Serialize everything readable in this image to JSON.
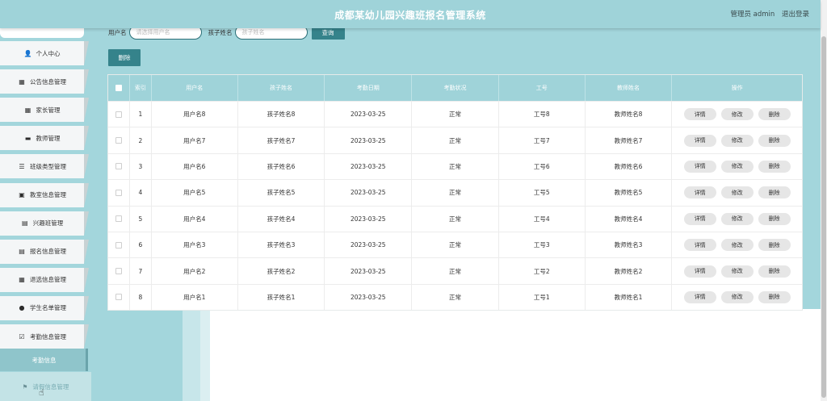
{
  "header": {
    "title": "成都某幼儿园兴趣班报名管理系统",
    "role": "管理员 admin",
    "logout": "退出登录"
  },
  "sidebar": {
    "items": [
      {
        "label": "个人中心",
        "icon": "user-icon"
      },
      {
        "label": "公告信息管理",
        "icon": "grid-icon"
      },
      {
        "label": "家长管理",
        "icon": "grid-icon"
      },
      {
        "label": "教师管理",
        "icon": "briefcase-icon"
      },
      {
        "label": "班级类型管理",
        "icon": "sliders-icon"
      },
      {
        "label": "教室信息管理",
        "icon": "classroom-icon"
      },
      {
        "label": "兴趣班管理",
        "icon": "clipboard-icon"
      },
      {
        "label": "报名信息管理",
        "icon": "document-icon"
      },
      {
        "label": "退选信息管理",
        "icon": "grid-icon"
      },
      {
        "label": "学生名单管理",
        "icon": "pin-icon"
      },
      {
        "label": "考勤信息管理",
        "icon": "check-icon"
      }
    ],
    "sub_item": "考勤信息",
    "last_item": {
      "label": "请假信息管理",
      "icon": "flag-icon"
    }
  },
  "search": {
    "username_label": "用户名",
    "username_placeholder": "请选择用户名",
    "child_label": "孩子姓名",
    "child_placeholder": "孩子姓名",
    "query_button": "查询"
  },
  "toolbar": {
    "delete_label": "删除"
  },
  "table": {
    "headers": [
      "索引",
      "用户名",
      "孩子姓名",
      "考勤日期",
      "考勤状况",
      "工号",
      "教师姓名",
      "操作"
    ],
    "actions": [
      "详情",
      "修改",
      "删除"
    ],
    "rows": [
      {
        "index": "1",
        "username": "用户名8",
        "child": "孩子姓名8",
        "date": "2023-03-25",
        "status": "正常",
        "job_no": "工号8",
        "teacher": "教师姓名8"
      },
      {
        "index": "2",
        "username": "用户名7",
        "child": "孩子姓名7",
        "date": "2023-03-25",
        "status": "正常",
        "job_no": "工号7",
        "teacher": "教师姓名7"
      },
      {
        "index": "3",
        "username": "用户名6",
        "child": "孩子姓名6",
        "date": "2023-03-25",
        "status": "正常",
        "job_no": "工号6",
        "teacher": "教师姓名6"
      },
      {
        "index": "4",
        "username": "用户名5",
        "child": "孩子姓名5",
        "date": "2023-03-25",
        "status": "正常",
        "job_no": "工号5",
        "teacher": "教师姓名5"
      },
      {
        "index": "5",
        "username": "用户名4",
        "child": "孩子姓名4",
        "date": "2023-03-25",
        "status": "正常",
        "job_no": "工号4",
        "teacher": "教师姓名4"
      },
      {
        "index": "6",
        "username": "用户名3",
        "child": "孩子姓名3",
        "date": "2023-03-25",
        "status": "正常",
        "job_no": "工号3",
        "teacher": "教师姓名3"
      },
      {
        "index": "7",
        "username": "用户名2",
        "child": "孩子姓名2",
        "date": "2023-03-25",
        "status": "正常",
        "job_no": "工号2",
        "teacher": "教师姓名2"
      },
      {
        "index": "8",
        "username": "用户名1",
        "child": "孩子姓名1",
        "date": "2023-03-25",
        "status": "正常",
        "job_no": "工号1",
        "teacher": "教师姓名1"
      }
    ]
  },
  "colors": {
    "accent": "#9fd3d9",
    "button": "#35838b",
    "sidebar": "#a3d6dc"
  }
}
